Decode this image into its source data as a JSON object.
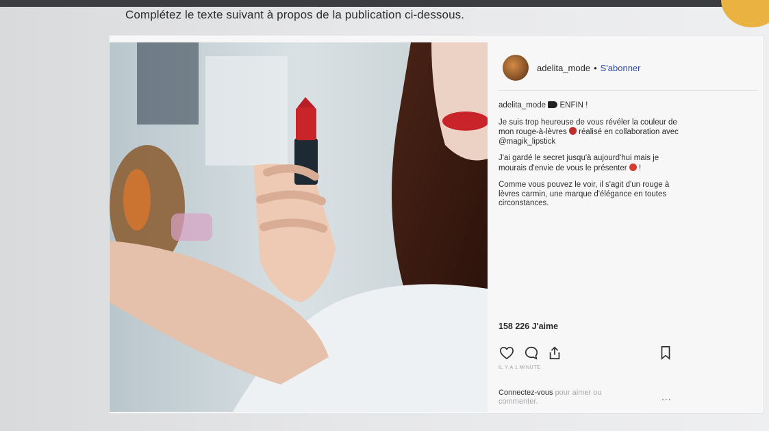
{
  "instruction": "Complétez le texte suivant à propos de la publication ci-dessous.",
  "post": {
    "username": "adelita_mode",
    "separator": "•",
    "follow_label": "S'abonner",
    "caption": {
      "username": "adelita_mode",
      "headline": "ENFIN !",
      "para1_before": "Je suis trop heureuse de vous révéler la couleur de mon rouge-à-lèvres",
      "para1_after": "réalisé en collaboration avec @magik_lipstick",
      "para2_before": "J'ai gardé le secret jusqu'à aujourd'hui mais je mourais d'envie de vous le présenter",
      "para2_after": "!",
      "para3": "Comme vous pouvez le voir, il s'agit d'un rouge à lèvres carmin, une marque d'élégance en toutes circonstances."
    },
    "likes": "158 226 J'aime",
    "time": "IL Y A 1 MINUTE",
    "login_strong": "Connectez-vous",
    "login_rest": "pour aimer ou commenter.",
    "more": "..."
  },
  "icons": {
    "like": "heart-outline-icon",
    "comment": "comment-bubble-icon",
    "share": "share-upload-icon",
    "save": "bookmark-icon"
  },
  "colors": {
    "follow_link": "#2d4aa3",
    "lipstick_red": "#c8242a"
  }
}
